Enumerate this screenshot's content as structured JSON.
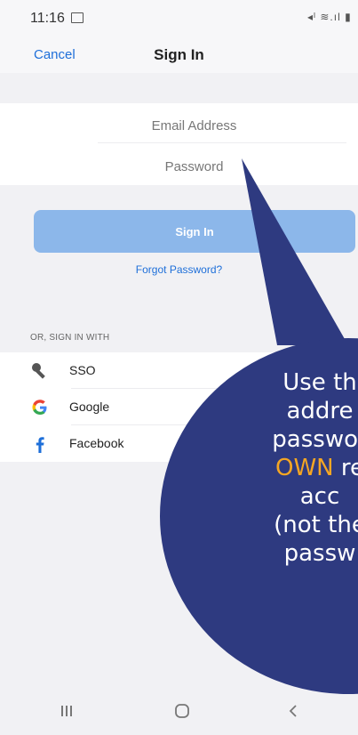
{
  "status_bar": {
    "time": "11:16",
    "right_icons": "◂ᴵ ≋.ıl ▮"
  },
  "header": {
    "cancel_label": "Cancel",
    "title": "Sign In"
  },
  "form": {
    "email_placeholder": "Email Address",
    "password_placeholder": "Password",
    "signin_label": "Sign In",
    "forgot_label": "Forgot Password?"
  },
  "alt_signin": {
    "label": "OR, SIGN IN WITH",
    "providers": [
      {
        "name": "SSO",
        "icon": "key-icon"
      },
      {
        "name": "Google",
        "icon": "google-icon"
      },
      {
        "name": "Facebook",
        "icon": "facebook-icon"
      }
    ]
  },
  "callout": {
    "line1": "Use th",
    "line2": "addre",
    "line3": "passwor",
    "line4_emph": "OWN",
    "line4_rest": " re",
    "line5": "acc",
    "line6": "(not the",
    "line7": "passw",
    "color": "#2e3a80",
    "emphasis_color": "#f5a623"
  },
  "colors": {
    "accent": "#1e6fd9",
    "button": "#8cb7ea",
    "google_blue": "#4285f4",
    "google_red": "#ea4335",
    "google_yellow": "#fbbc05",
    "google_green": "#34a853"
  },
  "system_nav": {
    "recents": "recents-icon",
    "home": "home-icon",
    "back": "back-icon"
  }
}
